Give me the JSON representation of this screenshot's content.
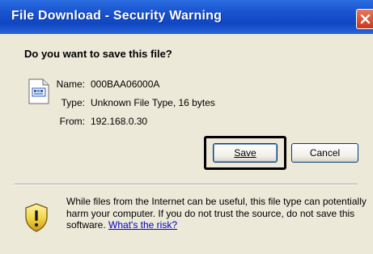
{
  "window": {
    "title": "File Download - Security Warning"
  },
  "dialog": {
    "question": "Do you want to save this file?",
    "file": {
      "name_label": "Name:",
      "name_value": "000BAA06000A",
      "type_label": "Type:",
      "type_value": "Unknown File Type, 16 bytes",
      "from_label": "From:",
      "from_value": "192.168.0.30"
    },
    "buttons": {
      "save_label": "Save",
      "cancel_label": "Cancel"
    },
    "warning": {
      "text": "While files from the Internet can be useful, this file type can potentially harm your computer. If you do not trust the source, do not save this software. ",
      "link_label": "What's the risk?"
    }
  },
  "icons": {
    "close": "close-icon",
    "file": "file-icon",
    "shield": "security-shield-icon"
  },
  "colors": {
    "titlebar": "#0f46c3",
    "client_bg": "#ece9d8",
    "close_button": "#c9391a",
    "link": "#0000cc"
  }
}
